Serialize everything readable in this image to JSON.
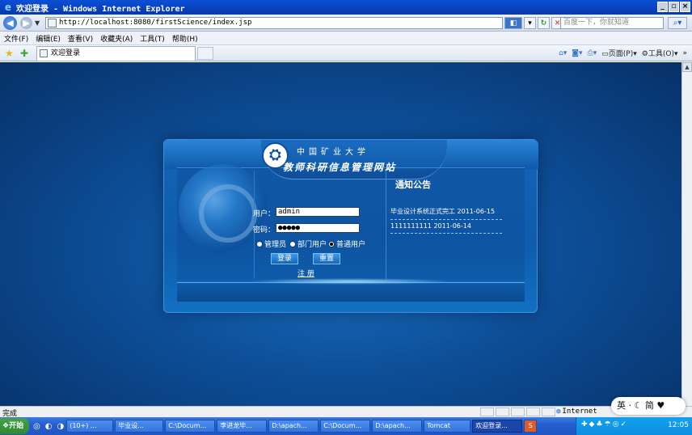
{
  "window": {
    "title": "欢迎登录 - Windows Internet Explorer",
    "controls": [
      "_",
      "▫",
      "×"
    ]
  },
  "address_bar": {
    "url": "http://localhost:8080/firstScience/index.jsp",
    "search_placeholder": "百度一下，你就知道"
  },
  "menu": [
    "文件(F)",
    "编辑(E)",
    "查看(V)",
    "收藏夹(A)",
    "工具(T)",
    "帮助(H)"
  ],
  "tab": {
    "label": "欢迎登录"
  },
  "command_bar": {
    "page": "页面(P)",
    "tools": "工具(O)"
  },
  "header": {
    "university": "中国矿业大学",
    "site_title": "教师科研信息管理网站"
  },
  "login": {
    "username_label": "用户：",
    "username_value": "admin",
    "password_label": "密码：",
    "password_value": "●●●●●",
    "roles": [
      {
        "label": "管理员",
        "selected": false
      },
      {
        "label": "部门用户",
        "selected": false
      },
      {
        "label": "普通用户",
        "selected": true
      }
    ],
    "login_button": "登录",
    "reset_button": "重置",
    "register_link": "注 册"
  },
  "notices": {
    "title": "通知公告",
    "items": [
      {
        "text": "毕业设计系统正式完工 2011-06-15"
      },
      {
        "text": "1111111111 2011-06-14"
      }
    ]
  },
  "status_bar": {
    "status": "完成",
    "zone": "Internet"
  },
  "ime": {
    "text": "英 · ☾ 简 ♥"
  },
  "taskbar": {
    "start": "开始",
    "tasks": [
      {
        "label": "(10+) ...",
        "active": false
      },
      {
        "label": "毕业设...",
        "active": false
      },
      {
        "label": "C:\\Docum...",
        "active": false
      },
      {
        "label": "李进龙毕...",
        "active": false
      },
      {
        "label": "D:\\apach...",
        "active": false
      },
      {
        "label": "C:\\Docum...",
        "active": false
      },
      {
        "label": "D:\\apach...",
        "active": false
      },
      {
        "label": "Tomcat",
        "active": false
      },
      {
        "label": "欢迎登录...",
        "active": true
      }
    ],
    "clock": "12:05"
  }
}
